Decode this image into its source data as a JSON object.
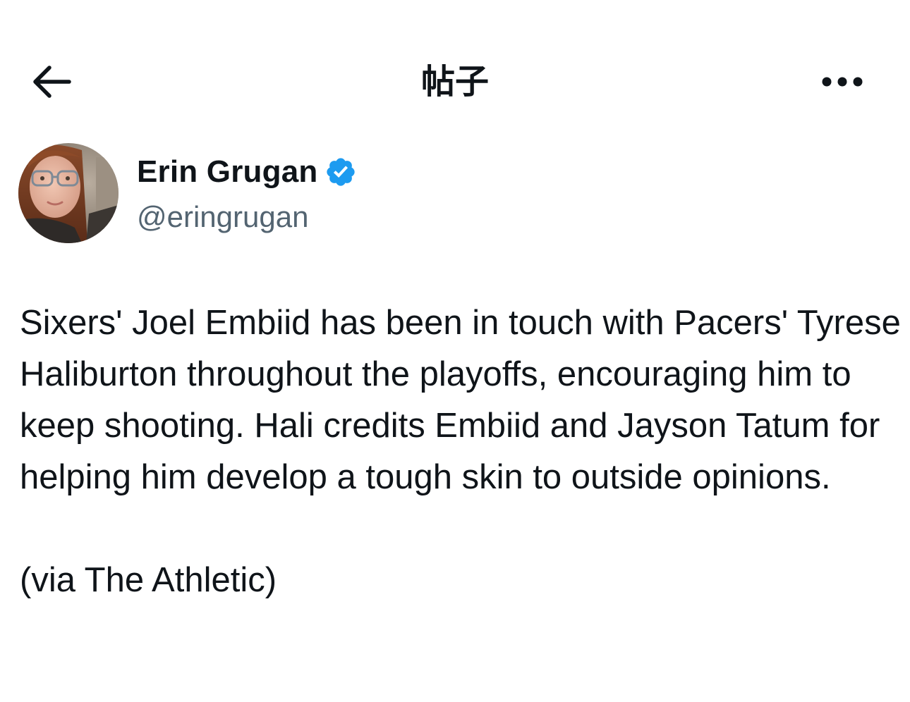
{
  "header": {
    "title": "帖子",
    "back_icon": "arrow-left-icon",
    "more_icon": "more-horizontal-icon"
  },
  "author": {
    "display_name": "Erin Grugan",
    "handle": "@eringrugan",
    "verified_icon": "verified-badge-icon",
    "verified_color": "#1d9bf0"
  },
  "tweet": {
    "paragraphs": [
      "Sixers' Joel Embiid has been in touch with Pacers' Tyrese Haliburton throughout the playoffs, encouraging him to keep shooting. Hali credits Embiid and Jayson Tatum for helping him develop a tough skin to outside opinions.",
      "(via The Athletic)"
    ]
  },
  "colors": {
    "text": "#0f1419",
    "secondary_text": "#536471",
    "background": "#ffffff"
  }
}
